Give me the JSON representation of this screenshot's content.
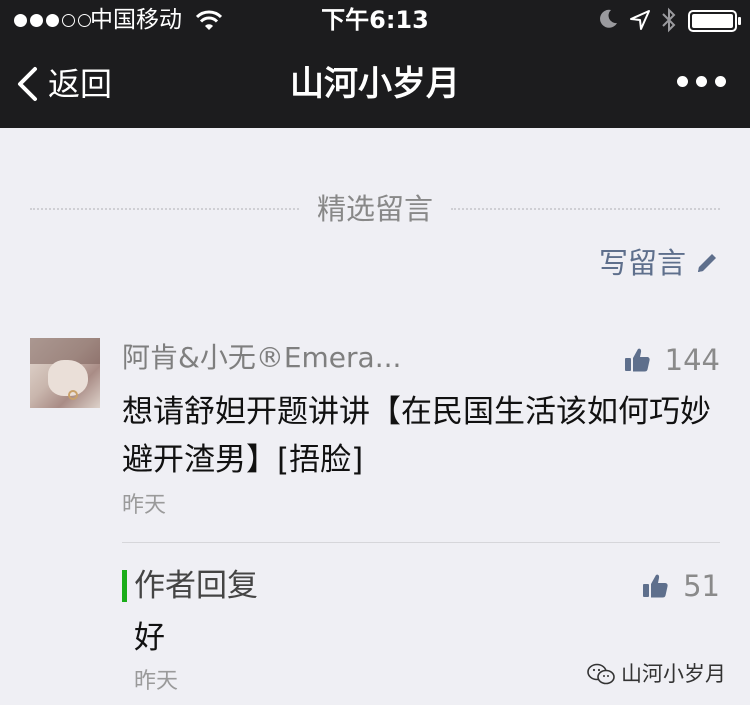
{
  "status_bar": {
    "carrier": "中国移动",
    "time": "下午6:13",
    "signal_strength": 3,
    "signal_max": 5
  },
  "nav": {
    "back_label": "返回",
    "title": "山河小岁月"
  },
  "featured": {
    "section_title": "精选留言",
    "write_comment_label": "写留言"
  },
  "comment": {
    "author": "阿肯&小无®Emera...",
    "likes": "144",
    "text": "想请舒妲开题讲讲【在民国生活该如何巧妙避开渣男】[捂脸]",
    "time": "昨天"
  },
  "reply": {
    "label": "作者回复",
    "likes": "51",
    "text": "好",
    "time": "昨天"
  },
  "watermark": {
    "label": "山河小岁月"
  },
  "colors": {
    "nav_background": "#1c1c1e",
    "page_background": "#efeff4",
    "link_blue_gray": "#5e6f8c",
    "reply_accent_green": "#1aad19"
  }
}
